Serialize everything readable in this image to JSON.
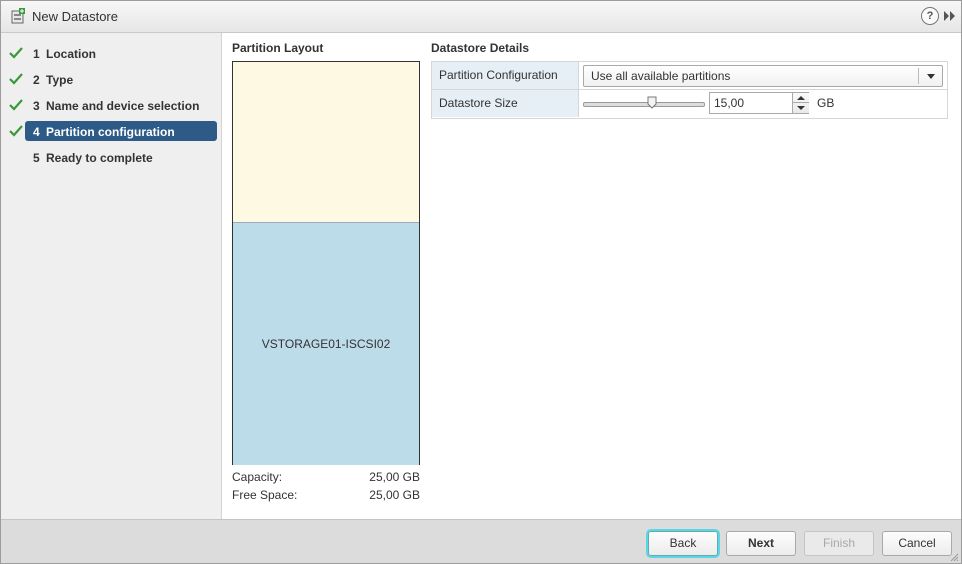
{
  "window": {
    "title": "New Datastore",
    "icon": "datastore-add-icon",
    "help_label": "?"
  },
  "steps": [
    {
      "number": "1",
      "label": "Location",
      "done": true,
      "active": false
    },
    {
      "number": "2",
      "label": "Type",
      "done": true,
      "active": false
    },
    {
      "number": "3",
      "label": "Name and device selection",
      "done": true,
      "active": false
    },
    {
      "number": "4",
      "label": "Partition configuration",
      "done": true,
      "active": true
    },
    {
      "number": "5",
      "label": "Ready to complete",
      "done": false,
      "active": false
    }
  ],
  "partition_layout": {
    "title": "Partition Layout",
    "used_label": "VSTORAGE01-ISCSI02",
    "capacity_label": "Capacity:",
    "capacity_value": "25,00 GB",
    "free_label": "Free Space:",
    "free_value": "25,00 GB"
  },
  "details": {
    "title": "Datastore Details",
    "partition_config_label": "Partition Configuration",
    "partition_config_value": "Use all available partitions",
    "size_label": "Datastore Size",
    "size_value": "15,00",
    "size_unit": "GB"
  },
  "footer": {
    "back": "Back",
    "next": "Next",
    "finish": "Finish",
    "cancel": "Cancel"
  },
  "colors": {
    "active_step": "#2d5a87",
    "check": "#3a9a3a",
    "free_space": "#fef9e3",
    "used_space": "#bddcea",
    "focus_ring": "#5bd6e8"
  }
}
